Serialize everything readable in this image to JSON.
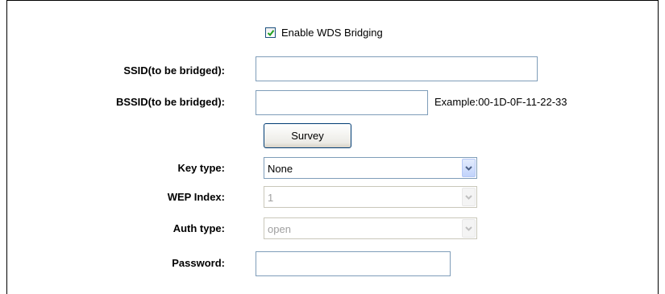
{
  "wds": {
    "enable_label": "Enable WDS Bridging",
    "enable_checked": true
  },
  "fields": {
    "ssid_label": "SSID(to be bridged):",
    "ssid_value": "",
    "bssid_label": "BSSID(to be bridged):",
    "bssid_value": "",
    "bssid_example": "Example:00-1D-0F-11-22-33",
    "survey_button": "Survey",
    "key_type_label": "Key type:",
    "key_type_value": "None",
    "wep_index_label": "WEP Index:",
    "wep_index_value": "1",
    "auth_type_label": "Auth type:",
    "auth_type_value": "open",
    "password_label": "Password:",
    "password_value": ""
  },
  "icons": {
    "checkbox_check": "checkmark-icon",
    "dropdown": "chevron-down-icon"
  },
  "colors": {
    "checkmark": "#21a121",
    "dropdown_arrow": "#4d6185"
  }
}
